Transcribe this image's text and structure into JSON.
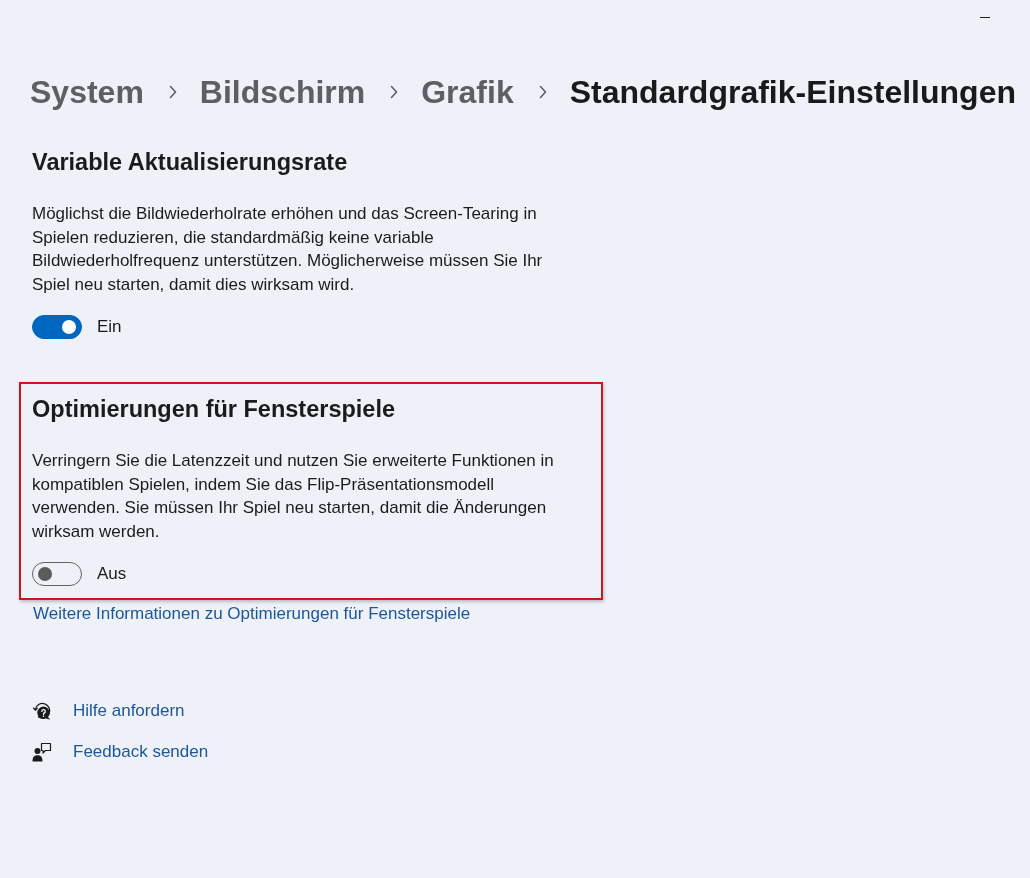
{
  "breadcrumb": [
    {
      "label": "System",
      "current": false
    },
    {
      "label": "Bildschirm",
      "current": false
    },
    {
      "label": "Grafik",
      "current": false
    },
    {
      "label": "Standardgrafik-Einstellungen",
      "current": true
    }
  ],
  "sections": [
    {
      "title": "Variable Aktualisierungsrate",
      "description": "Möglichst die Bildwiederholrate erhöhen und das Screen-Tearing in Spielen reduzieren, die standardmäßig keine variable Bildwiederholfrequenz unterstützen. Möglicherweise müssen Sie Ihr Spiel neu starten, damit dies wirksam wird.",
      "toggle": {
        "on": true,
        "label": "Ein"
      },
      "highlighted": false
    },
    {
      "title": "Optimierungen für Fensterspiele",
      "description": "Verringern Sie die Latenzzeit und nutzen Sie erweiterte Funktionen in kompatiblen Spielen, indem Sie das Flip-Präsentationsmodell verwenden. Sie müssen Ihr Spiel neu starten, damit die Änderungen wirksam werden.",
      "toggle": {
        "on": false,
        "label": "Aus"
      },
      "highlighted": true
    }
  ],
  "info_link": "Weitere Informationen zu Optimierungen für Fensterspiele",
  "help_links": [
    {
      "kind": "help",
      "label": "Hilfe anfordern"
    },
    {
      "kind": "feedback",
      "label": "Feedback senden"
    }
  ]
}
